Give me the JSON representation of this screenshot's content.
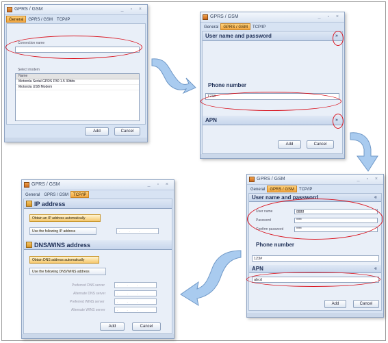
{
  "win1": {
    "title": "GPRS / GSM",
    "tabs": [
      "General",
      "GPRS / GSM",
      "TCP/IP"
    ],
    "connection_name_label": "Connection name",
    "connection_name_value": "",
    "select_modem_label": "Select modem",
    "modem_header": "Name",
    "modems": [
      "Motorola Serial GPRS P30 1.5 30bits",
      "Motorola USB Modem"
    ],
    "add": "Add",
    "cancel": "Cancel"
  },
  "win2": {
    "title": "GPRS / GSM",
    "tabs": [
      "General",
      "GPRS / GSM",
      "TCP/IP"
    ],
    "section_user": "User name and password",
    "phone_label": "Phone number",
    "phone_value": "123#",
    "section_apn": "APN",
    "add": "Add",
    "cancel": "Cancel"
  },
  "win3": {
    "title": "GPRS / GSM",
    "tabs": [
      "General",
      "GPRS / GSM",
      "TCP/IP"
    ],
    "section_user": "User name and password",
    "user_name_label": "User name",
    "user_name_value": "gggg",
    "password_label": "Password",
    "password_value": "****",
    "confirm_label": "Confirm password",
    "confirm_value": "****",
    "phone_label": "Phone number",
    "phone_value": "123#",
    "section_apn": "APN",
    "apn_value": "abcd",
    "add": "Add",
    "cancel": "Cancel"
  },
  "win4": {
    "title": "GPRS / GSM",
    "tabs": [
      "General",
      "GPRS / GSM",
      "TCP/IP"
    ],
    "section_ip": "IP address",
    "ip_auto": "Obtain an IP address automatically",
    "ip_manual": "Use the following IP address",
    "section_dns": "DNS/WINS address",
    "dns_auto": "Obtain DNS address automatically",
    "dns_manual": "Use the following DNS/WINS address",
    "dns_rows": [
      "Preferred DNS server",
      "Alternate DNS server",
      "Preferred WINS server",
      "Alternate WINS server"
    ],
    "ip_dots": ". . .",
    "add": "Add",
    "cancel": "Cancel"
  },
  "colors": {
    "highlight_oval": "#d9141f",
    "active_tab": "#f2a640",
    "arrow": "#9ec3ec"
  }
}
